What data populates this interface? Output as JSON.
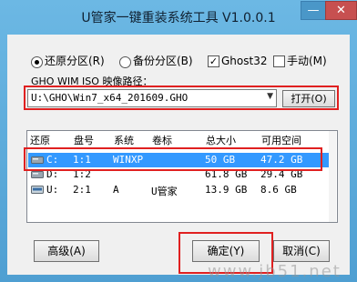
{
  "window": {
    "title": "U管家一键重装系统工具 V1.0.0.1",
    "minimize": "—",
    "close": "✕"
  },
  "options": {
    "restore": "还原分区(R)",
    "backup": "备份分区(B)",
    "ghost32": "Ghost32",
    "manual": "手动(M)",
    "ghost32_mark": "✓"
  },
  "path": {
    "label": "GHO WIM ISO 映像路径：",
    "value": "U:\\GHO\\Win7_x64_201609.GHO",
    "dropdown_icon": "chevron-down-icon",
    "open_button": "打开(O)"
  },
  "table": {
    "columns": [
      "还原",
      "盘号",
      "系统",
      "卷标",
      "总大小",
      "可用空间"
    ],
    "rows": [
      {
        "drive": "C:",
        "disk": "1:1",
        "system": "WINXP",
        "label": "",
        "total": "50 GB",
        "free": "47.2 GB",
        "selected": true
      },
      {
        "drive": "D:",
        "disk": "1:2",
        "system": "",
        "label": "",
        "total": "61.8 GB",
        "free": "29.4 GB",
        "selected": false
      },
      {
        "drive": "U:",
        "disk": "2:1",
        "system": "A",
        "label": "U管家",
        "total": "13.9 GB",
        "free": "8.6 GB",
        "selected": false
      }
    ]
  },
  "buttons": {
    "advanced": "高级(A)",
    "ok": "确定(Y)",
    "cancel": "取消(C)"
  },
  "watermark": "www.jb51.net",
  "colors": {
    "title_bar": "#5aa9d6",
    "highlight": "#e02020",
    "selection": "#3399ff"
  }
}
